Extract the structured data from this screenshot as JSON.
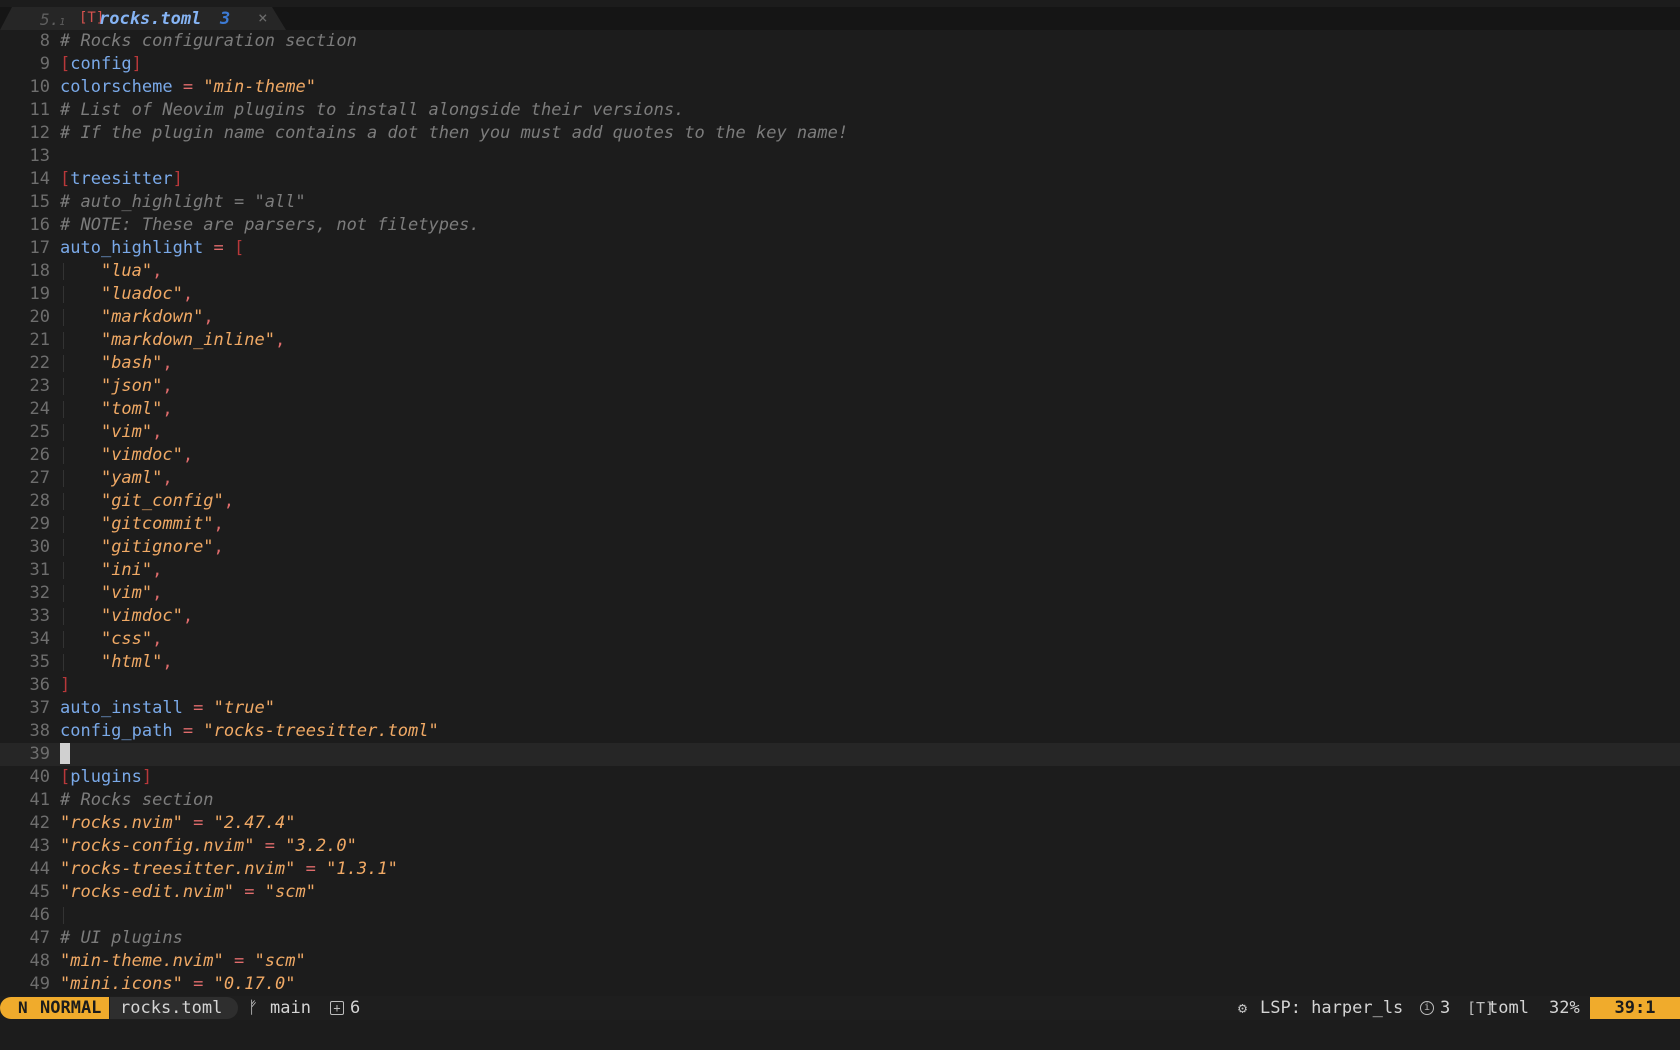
{
  "tabline": {
    "number": "5.",
    "number_sub": "1",
    "filetype_icon": "[T]",
    "filename": "rocks.toml",
    "diagnostic_count": "3",
    "close_icon": "×"
  },
  "editor": {
    "cursor_line": 39,
    "lines": [
      {
        "n": "8",
        "segs": [
          [
            "cm",
            "# Rocks configuration section"
          ]
        ]
      },
      {
        "n": "9",
        "segs": [
          [
            "br",
            "["
          ],
          [
            "sec",
            "config"
          ],
          [
            "br",
            "]"
          ]
        ]
      },
      {
        "n": "10",
        "segs": [
          [
            "key",
            "colorscheme"
          ],
          [
            "pl",
            " "
          ],
          [
            "eq",
            "="
          ],
          [
            "pl",
            " "
          ],
          [
            "str",
            "\"min-theme\""
          ]
        ]
      },
      {
        "n": "11",
        "segs": [
          [
            "cm",
            "# List of Neovim plugins to install alongside their versions."
          ]
        ]
      },
      {
        "n": "12",
        "segs": [
          [
            "cm",
            "# If the plugin name contains a dot then you must add quotes to the key name!"
          ]
        ]
      },
      {
        "n": "13",
        "segs": []
      },
      {
        "n": "14",
        "segs": [
          [
            "br",
            "["
          ],
          [
            "sec",
            "treesitter"
          ],
          [
            "br",
            "]"
          ]
        ]
      },
      {
        "n": "15",
        "segs": [
          [
            "cm",
            "# auto_highlight = \"all\""
          ]
        ]
      },
      {
        "n": "16",
        "segs": [
          [
            "cm",
            "# NOTE: These are parsers, not filetypes."
          ]
        ]
      },
      {
        "n": "17",
        "segs": [
          [
            "key",
            "auto_highlight"
          ],
          [
            "pl",
            " "
          ],
          [
            "eq",
            "="
          ],
          [
            "pl",
            " "
          ],
          [
            "br",
            "["
          ]
        ]
      },
      {
        "n": "18",
        "indent": true,
        "segs": [
          [
            "pl",
            "    "
          ],
          [
            "str",
            "\"lua\""
          ],
          [
            "eq",
            ","
          ]
        ]
      },
      {
        "n": "19",
        "indent": true,
        "segs": [
          [
            "pl",
            "    "
          ],
          [
            "str",
            "\"luadoc\""
          ],
          [
            "eq",
            ","
          ]
        ]
      },
      {
        "n": "20",
        "indent": true,
        "segs": [
          [
            "pl",
            "    "
          ],
          [
            "str",
            "\"markdown\""
          ],
          [
            "eq",
            ","
          ]
        ]
      },
      {
        "n": "21",
        "indent": true,
        "segs": [
          [
            "pl",
            "    "
          ],
          [
            "str",
            "\"markdown_inline\""
          ],
          [
            "eq",
            ","
          ]
        ]
      },
      {
        "n": "22",
        "indent": true,
        "segs": [
          [
            "pl",
            "    "
          ],
          [
            "str",
            "\"bash\""
          ],
          [
            "eq",
            ","
          ]
        ]
      },
      {
        "n": "23",
        "indent": true,
        "segs": [
          [
            "pl",
            "    "
          ],
          [
            "str",
            "\"json\""
          ],
          [
            "eq",
            ","
          ]
        ]
      },
      {
        "n": "24",
        "indent": true,
        "segs": [
          [
            "pl",
            "    "
          ],
          [
            "str",
            "\"toml\""
          ],
          [
            "eq",
            ","
          ]
        ]
      },
      {
        "n": "25",
        "indent": true,
        "segs": [
          [
            "pl",
            "    "
          ],
          [
            "str",
            "\"vim\""
          ],
          [
            "eq",
            ","
          ]
        ]
      },
      {
        "n": "26",
        "indent": true,
        "segs": [
          [
            "pl",
            "    "
          ],
          [
            "str",
            "\"vimdoc\""
          ],
          [
            "eq",
            ","
          ]
        ]
      },
      {
        "n": "27",
        "indent": true,
        "segs": [
          [
            "pl",
            "    "
          ],
          [
            "str",
            "\"yaml\""
          ],
          [
            "eq",
            ","
          ]
        ]
      },
      {
        "n": "28",
        "indent": true,
        "segs": [
          [
            "pl",
            "    "
          ],
          [
            "str",
            "\"git_config\""
          ],
          [
            "eq",
            ","
          ]
        ]
      },
      {
        "n": "29",
        "indent": true,
        "segs": [
          [
            "pl",
            "    "
          ],
          [
            "str",
            "\"gitcommit\""
          ],
          [
            "eq",
            ","
          ]
        ]
      },
      {
        "n": "30",
        "indent": true,
        "segs": [
          [
            "pl",
            "    "
          ],
          [
            "str",
            "\"gitignore\""
          ],
          [
            "eq",
            ","
          ]
        ]
      },
      {
        "n": "31",
        "indent": true,
        "segs": [
          [
            "pl",
            "    "
          ],
          [
            "str",
            "\"ini\""
          ],
          [
            "eq",
            ","
          ]
        ]
      },
      {
        "n": "32",
        "indent": true,
        "segs": [
          [
            "pl",
            "    "
          ],
          [
            "str",
            "\"vim\""
          ],
          [
            "eq",
            ","
          ]
        ]
      },
      {
        "n": "33",
        "indent": true,
        "segs": [
          [
            "pl",
            "    "
          ],
          [
            "str",
            "\"vimdoc\""
          ],
          [
            "eq",
            ","
          ]
        ]
      },
      {
        "n": "34",
        "indent": true,
        "segs": [
          [
            "pl",
            "    "
          ],
          [
            "str",
            "\"css\""
          ],
          [
            "eq",
            ","
          ]
        ]
      },
      {
        "n": "35",
        "indent": true,
        "segs": [
          [
            "pl",
            "    "
          ],
          [
            "str",
            "\"html\""
          ],
          [
            "eq",
            ","
          ]
        ]
      },
      {
        "n": "36",
        "segs": [
          [
            "br",
            "]"
          ]
        ]
      },
      {
        "n": "37",
        "segs": [
          [
            "key",
            "auto_install"
          ],
          [
            "pl",
            " "
          ],
          [
            "eq",
            "="
          ],
          [
            "pl",
            " "
          ],
          [
            "str",
            "\"true\""
          ]
        ]
      },
      {
        "n": "38",
        "segs": [
          [
            "key",
            "config_path"
          ],
          [
            "pl",
            " "
          ],
          [
            "eq",
            "="
          ],
          [
            "pl",
            " "
          ],
          [
            "str",
            "\"rocks-treesitter.toml\""
          ]
        ]
      },
      {
        "n": "39",
        "segs": [],
        "cursor": true
      },
      {
        "n": "40",
        "segs": [
          [
            "br",
            "["
          ],
          [
            "sec",
            "plugins"
          ],
          [
            "br",
            "]"
          ]
        ]
      },
      {
        "n": "41",
        "segs": [
          [
            "cm",
            "# Rocks section"
          ]
        ]
      },
      {
        "n": "42",
        "segs": [
          [
            "str",
            "\"rocks.nvim\""
          ],
          [
            "pl",
            " "
          ],
          [
            "eq",
            "="
          ],
          [
            "pl",
            " "
          ],
          [
            "str",
            "\"2.47.4\""
          ]
        ]
      },
      {
        "n": "43",
        "segs": [
          [
            "str",
            "\"rocks-config.nvim\""
          ],
          [
            "pl",
            " "
          ],
          [
            "eq",
            "="
          ],
          [
            "pl",
            " "
          ],
          [
            "str",
            "\"3.2.0\""
          ]
        ]
      },
      {
        "n": "44",
        "segs": [
          [
            "str",
            "\"rocks-treesitter.nvim\""
          ],
          [
            "pl",
            " "
          ],
          [
            "eq",
            "="
          ],
          [
            "pl",
            " "
          ],
          [
            "str",
            "\"1.3.1\""
          ]
        ]
      },
      {
        "n": "45",
        "segs": [
          [
            "str",
            "\"rocks-edit.nvim\""
          ],
          [
            "pl",
            " "
          ],
          [
            "eq",
            "="
          ],
          [
            "pl",
            " "
          ],
          [
            "str",
            "\"scm\""
          ]
        ]
      },
      {
        "n": "46",
        "indent": true,
        "segs": []
      },
      {
        "n": "47",
        "segs": [
          [
            "cm",
            "# UI plugins"
          ]
        ]
      },
      {
        "n": "48",
        "segs": [
          [
            "str",
            "\"min-theme.nvim\""
          ],
          [
            "pl",
            " "
          ],
          [
            "eq",
            "="
          ],
          [
            "pl",
            " "
          ],
          [
            "str",
            "\"scm\""
          ]
        ]
      },
      {
        "n": "49",
        "segs": [
          [
            "str",
            "\"mini.icons\""
          ],
          [
            "pl",
            " "
          ],
          [
            "eq",
            "="
          ],
          [
            "pl",
            " "
          ],
          [
            "str",
            "\"0.17.0\""
          ]
        ]
      }
    ]
  },
  "statusline": {
    "mode_icon": "N",
    "mode": "NORMAL",
    "filename": "rocks.toml",
    "branch_icon": "ᚠ",
    "branch": "main",
    "changes_icon": "+",
    "changes": "6",
    "lsp_icon": "⚙",
    "lsp": "LSP: harper_ls",
    "info_icon": "i",
    "info_count": "3",
    "filetype_icon": "[T]",
    "filetype": "toml",
    "percent": "32%",
    "position": "39:1"
  },
  "colors": {
    "background": "#1c1c1c",
    "accent": "#f0ab2c",
    "string": "#f0a965",
    "key": "#7aa9e8",
    "bracket": "#b8383a",
    "comment": "#7c7c7c"
  }
}
